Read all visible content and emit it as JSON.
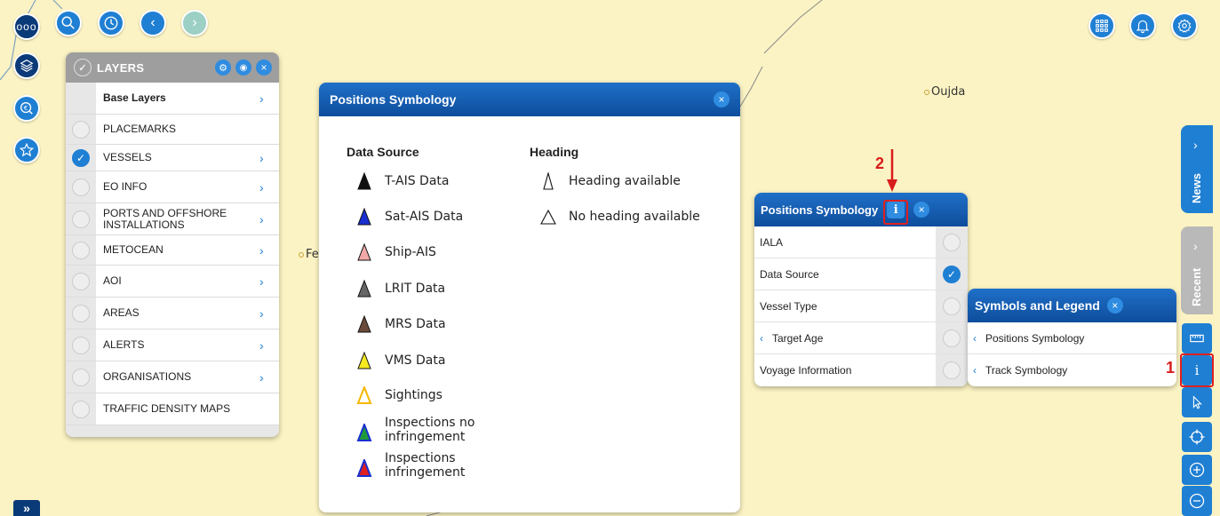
{
  "map": {
    "places": [
      {
        "name": "Oujda"
      },
      {
        "name": "Fe"
      }
    ]
  },
  "toolbar": {
    "menu_icon": "more-dots-icon",
    "search_icon": "search-icon",
    "history_icon": "clock-icon",
    "back_icon": "chevron-left-icon",
    "forward_icon": "chevron-right-icon",
    "apps_icon": "grid-icon",
    "bell_icon": "bell-icon",
    "settings_icon": "gear-icon"
  },
  "layers": {
    "title": "LAYERS",
    "items": [
      {
        "label": "Base Layers",
        "checked": false,
        "arrow": true
      },
      {
        "label": "PLACEMARKS",
        "checked": false,
        "arrow": false
      },
      {
        "label": "VESSELS",
        "checked": true,
        "arrow": true
      },
      {
        "label": "EO INFO",
        "checked": false,
        "arrow": true
      },
      {
        "label": "PORTS AND OFFSHORE INSTALLATIONS",
        "checked": false,
        "arrow": true
      },
      {
        "label": "METOCEAN",
        "checked": false,
        "arrow": true
      },
      {
        "label": "AOI",
        "checked": false,
        "arrow": true
      },
      {
        "label": "AREAS",
        "checked": false,
        "arrow": true
      },
      {
        "label": "ALERTS",
        "checked": false,
        "arrow": true
      },
      {
        "label": "ORGANISATIONS",
        "checked": false,
        "arrow": true
      },
      {
        "label": "TRAFFIC DENSITY MAPS",
        "checked": false,
        "arrow": false
      }
    ]
  },
  "positions_symbology_legend": {
    "title": "Positions Symbology",
    "close": "×",
    "data_source_title": "Data Source",
    "heading_title": "Heading",
    "data_sources": [
      {
        "label": "T-AIS Data",
        "color": "#111111",
        "color2": ""
      },
      {
        "label": "Sat-AIS Data",
        "color": "#1a2fd0",
        "color2": ""
      },
      {
        "label": "Ship-AIS",
        "color": "#f2a8a8",
        "color2": ""
      },
      {
        "label": "LRIT Data",
        "color": "#666666",
        "color2": ""
      },
      {
        "label": "MRS Data",
        "color": "#6b4a3a",
        "color2": ""
      },
      {
        "label": "VMS Data",
        "color": "#f5e920",
        "color2": ""
      },
      {
        "label": "Sightings",
        "color": "#ffffff",
        "color2": "#f5b700"
      },
      {
        "label": "Inspections no infringement",
        "color": "#1f9a3a",
        "color2": "#1a2fd0"
      },
      {
        "label": "Inspections infringement",
        "color": "#e02020",
        "color2": "#1a2fd0"
      }
    ],
    "headings": [
      {
        "label": "Heading available"
      },
      {
        "label": "No heading available"
      }
    ]
  },
  "positions_symbology_panel": {
    "title": "Positions Symbology",
    "info": "i",
    "close": "×",
    "options": [
      {
        "label": "IALA",
        "checked": false,
        "chevron": false
      },
      {
        "label": "Data Source",
        "checked": true,
        "chevron": false
      },
      {
        "label": "Vessel Type",
        "checked": false,
        "chevron": false
      },
      {
        "label": "Target Age",
        "checked": false,
        "chevron": true
      },
      {
        "label": "Voyage Information",
        "checked": false,
        "chevron": false
      }
    ]
  },
  "symbols_legend": {
    "title": "Symbols and Legend",
    "close": "×",
    "items": [
      {
        "label": "Positions Symbology"
      },
      {
        "label": "Track Symbology"
      }
    ]
  },
  "side_tabs": {
    "news": "News",
    "recent": "Recent",
    "chev": "›"
  },
  "annotations": {
    "one": "1",
    "two": "2"
  },
  "expand_label": "»"
}
